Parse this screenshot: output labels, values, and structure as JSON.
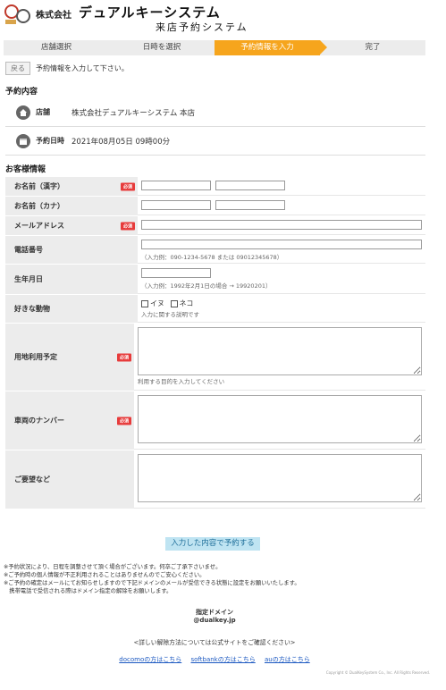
{
  "header": {
    "company": "株式会社",
    "brand": "デュアルキーシステム",
    "system": "来店予約システム"
  },
  "steps": [
    {
      "label": "店舗選択",
      "active": false
    },
    {
      "label": "日時を選択",
      "active": false
    },
    {
      "label": "予約情報を入力",
      "active": true
    },
    {
      "label": "完了",
      "active": false
    }
  ],
  "nav": {
    "back_label": "戻る",
    "instruction": "予約情報を入力して下さい。"
  },
  "reservation": {
    "title": "予約内容",
    "store_label": "店舗",
    "store_value": "株式会社デュアルキーシステム 本店",
    "datetime_label": "予約日時",
    "datetime_value": "2021年08月05日 09時00分"
  },
  "customer": {
    "title": "お客様情報",
    "required_badge": "必須",
    "name_kanji": "お名前（漢字）",
    "name_kana": "お名前（カナ）",
    "email": "メールアドレス",
    "phone": "電話番号",
    "phone_hint": "（入力例：090-1234-5678 または 09012345678）",
    "birthday": "生年月日",
    "birthday_hint": "（入力例：1992年2月1日の場合 → 19920201）",
    "animal": "好きな動物",
    "animal_options": [
      "イヌ",
      "ネコ"
    ],
    "animal_hint": "入力に関する説明です",
    "purpose": "用地利用予定",
    "purpose_hint": "利用する目的を入力してください",
    "vehicle": "車両のナンバー",
    "requests": "ご要望など"
  },
  "submit_label": "入力した内容で予約する",
  "notes": [
    "※予約状況により、日程を調整させて頂く場合がございます。何卒ご了承下さいませ。",
    "※ご予約時の個人情報が不正利用されることはありませんのでご安心ください。",
    "※ご予約の確定はメールにてお知らせしますので下記ドメインのメールが受信できる状態に設定をお願いいたします。",
    "　携帯電話で受信される際はドメイン指定の解除をお願いします。"
  ],
  "domain": {
    "label": "指定ドメイン",
    "value": "@dualkey.jp"
  },
  "detail_text": "<詳しい解除方法については公式サイトをご確認ください>",
  "links": {
    "docomo": "docomoの方はこちら",
    "softbank": "softbankの方はこちら",
    "au": "auの方はこちら"
  },
  "copyright": "Copyright © DualKeySystem Co., Inc. All Rights Reserved.",
  "colors": {
    "accent": "#f6a51d",
    "required": "#e73b3b",
    "submit_bg": "#bfe4f2",
    "link": "#1a57c0"
  }
}
